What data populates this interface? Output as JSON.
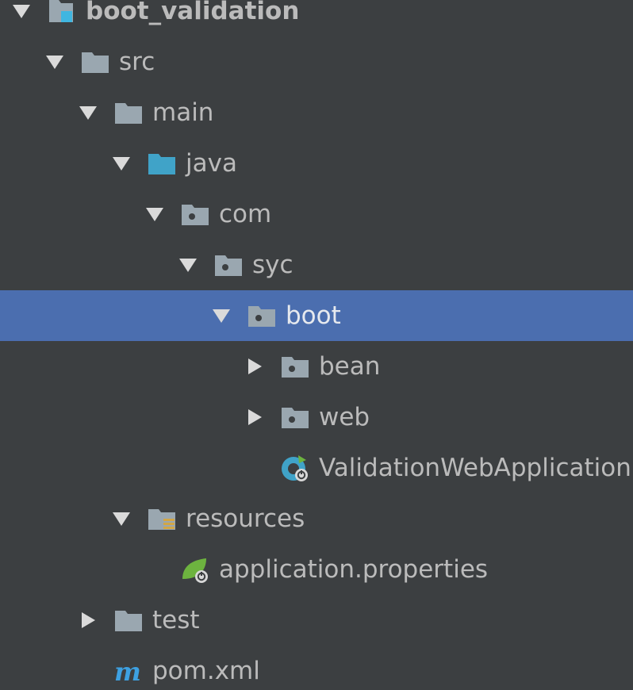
{
  "project_tree": {
    "items": [
      {
        "label": "boot_validation",
        "icon": "project-module-icon",
        "arrow": "expanded",
        "depth": 0,
        "bold": true
      },
      {
        "label": "src",
        "icon": "folder-icon",
        "arrow": "expanded",
        "depth": 1
      },
      {
        "label": "main",
        "icon": "folder-icon",
        "arrow": "expanded",
        "depth": 2
      },
      {
        "label": "java",
        "icon": "source-root-folder-icon",
        "arrow": "expanded",
        "depth": 3
      },
      {
        "label": "com",
        "icon": "package-icon",
        "arrow": "expanded",
        "depth": 4
      },
      {
        "label": "syc",
        "icon": "package-icon",
        "arrow": "expanded",
        "depth": 5
      },
      {
        "label": "boot",
        "icon": "package-icon",
        "arrow": "expanded",
        "depth": 6,
        "selected": true
      },
      {
        "label": "bean",
        "icon": "package-icon",
        "arrow": "collapsed",
        "depth": 7
      },
      {
        "label": "web",
        "icon": "package-icon",
        "arrow": "collapsed",
        "depth": 7
      },
      {
        "label": "ValidationWebApplication",
        "icon": "spring-boot-class-icon",
        "arrow": "none",
        "depth": 7
      },
      {
        "label": "resources",
        "icon": "resources-folder-icon",
        "arrow": "expanded",
        "depth": 3
      },
      {
        "label": "application.properties",
        "icon": "spring-properties-icon",
        "arrow": "none",
        "depth": 4
      },
      {
        "label": "test",
        "icon": "folder-icon",
        "arrow": "collapsed",
        "depth": 2
      },
      {
        "label": "pom.xml",
        "icon": "maven-icon",
        "arrow": "none",
        "depth": 2
      }
    ]
  },
  "colors": {
    "background": "#3c3f41",
    "selection": "#4b6eaf",
    "text": "#bbbbbb",
    "folder": "#9aa7b0",
    "source_root": "#40a3c8",
    "module_badge": "#40b6e0",
    "resources_badge": "#d2a646",
    "spring_green": "#6db33f",
    "maven": "#3da1e2"
  }
}
